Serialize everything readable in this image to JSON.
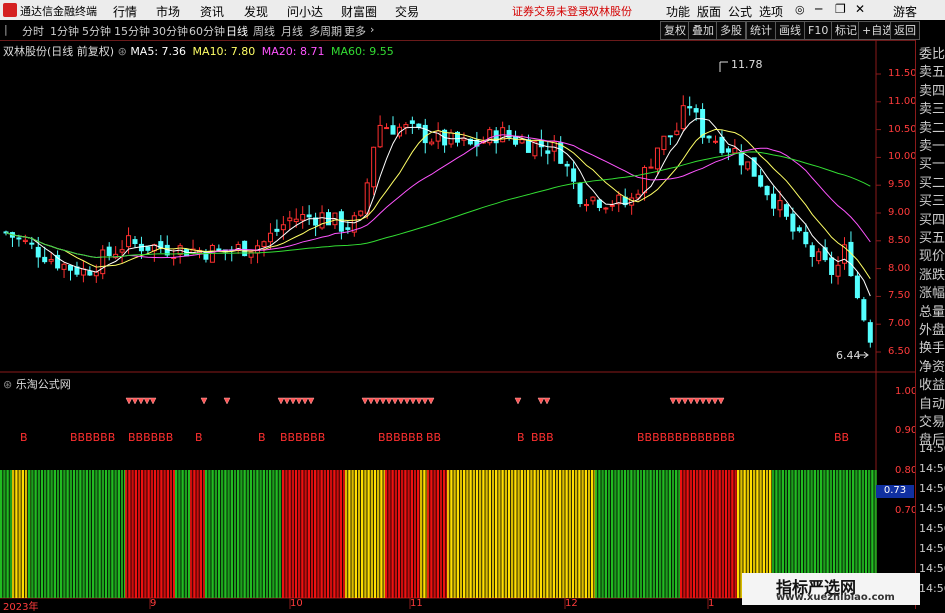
{
  "app": {
    "title": "通达信金融终端"
  },
  "menu": {
    "items": [
      "行情",
      "市场",
      "资讯",
      "发现",
      "问小达",
      "财富圈",
      "交易"
    ],
    "alert": "证券交易未登录",
    "stock": "双林股份",
    "right_items": [
      "功能",
      "版面",
      "公式",
      "选项"
    ],
    "user": "游客"
  },
  "toolbar": {
    "periods": [
      "分时",
      "1分钟",
      "5分钟",
      "15分钟",
      "30分钟",
      "60分钟",
      "日线",
      "周线",
      "月线",
      "多周期",
      "更多"
    ],
    "active_period": "日线",
    "buttons": [
      "复权",
      "叠加",
      "多股",
      "统计",
      "画线",
      "F10",
      "标记",
      "+自选",
      "返回"
    ]
  },
  "main_chart": {
    "header": "双林股份(日线 前复权)",
    "ma": [
      {
        "label": "MA5:",
        "value": "7.36",
        "color": "#ffffff"
      },
      {
        "label": "MA10:",
        "value": "7.80",
        "color": "#ffff66"
      },
      {
        "label": "MA20:",
        "value": "8.71",
        "color": "#ff55ff"
      },
      {
        "label": "MA60:",
        "value": "9.55",
        "color": "#33dd33"
      }
    ],
    "high_label": "11.78",
    "low_label": "6.44",
    "y_ticks": [
      "11.50",
      "11.00",
      "10.50",
      "10.00",
      "9.50",
      "9.00",
      "8.50",
      "8.00",
      "7.50",
      "7.00",
      "6.50"
    ]
  },
  "indicator": {
    "header": "乐淘公式网",
    "y_ticks": [
      "1.00",
      "0.90",
      "0.80",
      "0.73",
      "0.70"
    ],
    "b_marks": [
      "B",
      "BBBBBB",
      "BBBBBB",
      "B",
      "B",
      "BBBBBB",
      "BBBBBB",
      "BB",
      "B",
      "BBB",
      "BBBBBBBBBBBBB",
      "BB"
    ]
  },
  "x_axis": {
    "labels": [
      "2023年",
      "9",
      "10",
      "11",
      "12",
      "1"
    ]
  },
  "right_panel": {
    "items": [
      "委比",
      "卖五",
      "卖四",
      "卖三",
      "卖二",
      "卖一",
      "买一",
      "买二",
      "买三",
      "买四",
      "买五",
      "现价",
      "涨跌",
      "涨幅",
      "总量",
      "外盘",
      "换手",
      "净资",
      "收益",
      "自动",
      "交易",
      "盘后"
    ],
    "times": [
      "14:56",
      "14:56",
      "14:56",
      "14:56",
      "14:56",
      "14:56",
      "14:56",
      "14:56"
    ]
  },
  "watermark": {
    "text": "指标严选网",
    "url": "www.xuezhibiao.com"
  }
}
